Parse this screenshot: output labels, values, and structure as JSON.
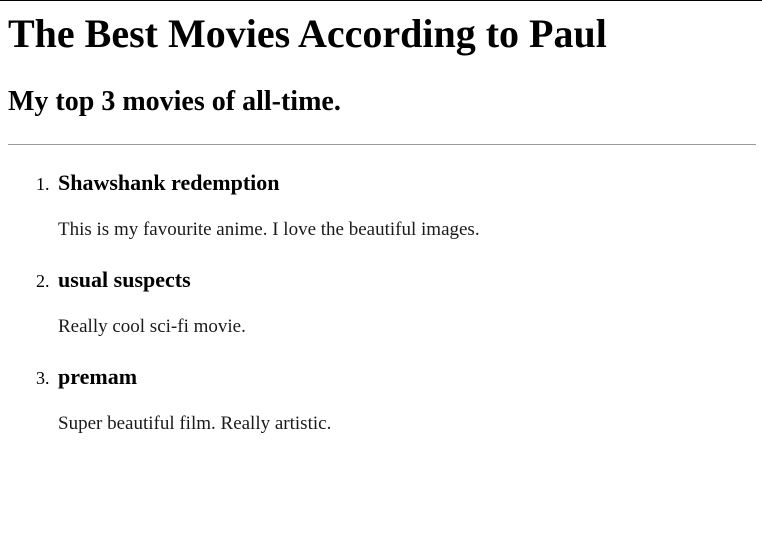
{
  "header": {
    "title": "The Best Movies According to Paul",
    "subtitle": "My top 3 movies of all-time."
  },
  "movies": [
    {
      "number": "1.",
      "title": "Shawshank redemption",
      "description": "This is my favourite anime. I love the beautiful images."
    },
    {
      "number": "2.",
      "title": "usual suspects",
      "description": "Really cool sci-fi movie."
    },
    {
      "number": "3.",
      "title": "premam",
      "description": "Super beautiful film. Really artistic."
    }
  ]
}
